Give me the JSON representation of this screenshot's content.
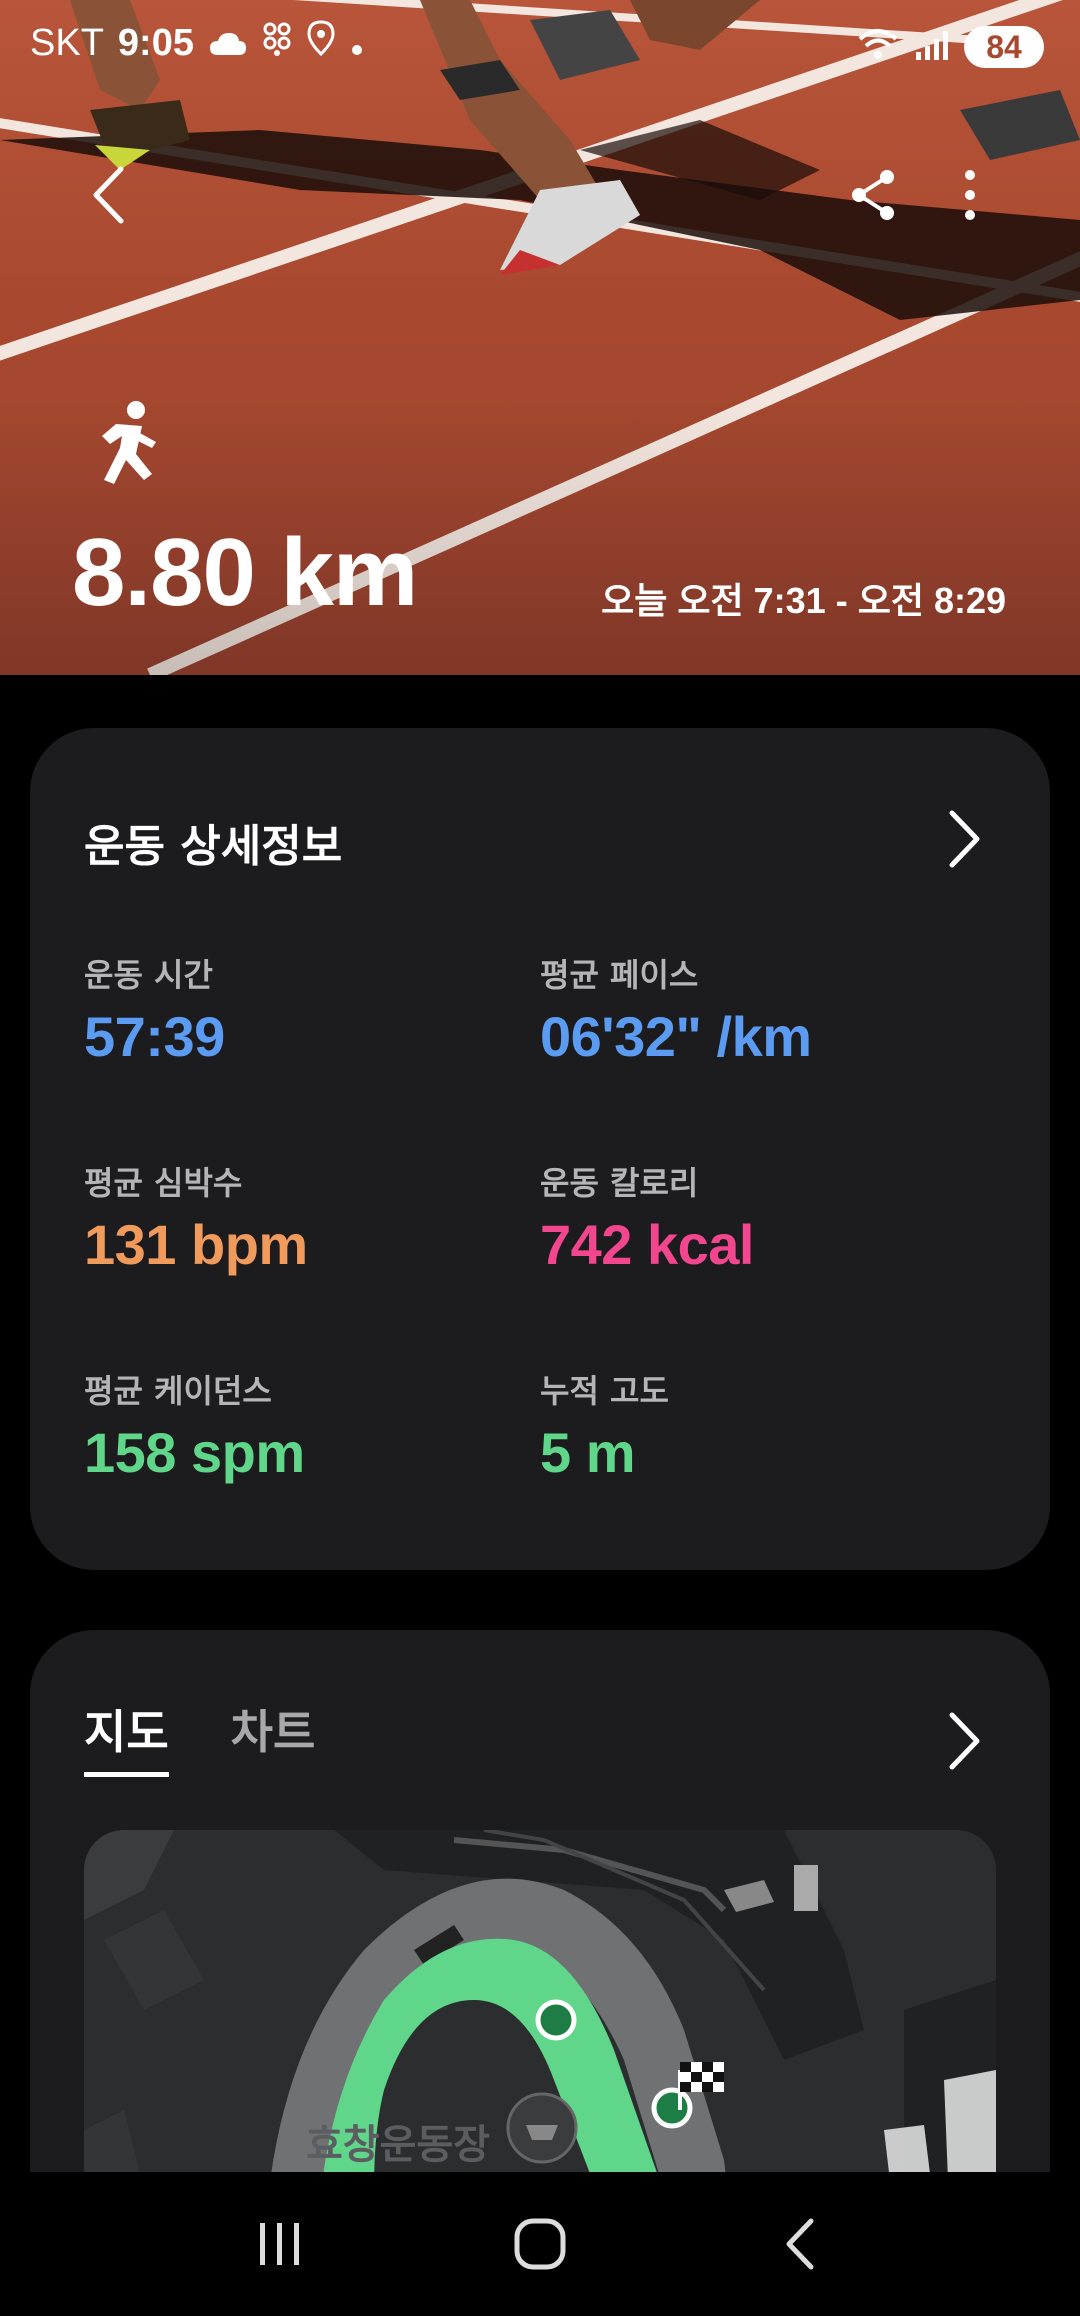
{
  "status_bar": {
    "carrier": "SKT",
    "time": "9:05",
    "battery": "84",
    "icons": [
      "cloud-icon",
      "grid-app-icon",
      "location-icon",
      "dot-icon",
      "wifi-icon",
      "signal-icon"
    ]
  },
  "hero": {
    "exercise_icon": "running-icon",
    "distance": "8.80 km",
    "time_range": "오늘 오전 7:31 - 오전 8:29"
  },
  "details": {
    "title": "운동 상세정보",
    "metrics": [
      {
        "label": "운동 시간",
        "value": "57:39",
        "color": "#5b9cf2"
      },
      {
        "label": "평균 페이스",
        "value": "06'32\" /km",
        "color": "#5b9cf2"
      },
      {
        "label": "평균 심박수",
        "value": "131 bpm",
        "color": "#f09a5c"
      },
      {
        "label": "운동 칼로리",
        "value": "742 kcal",
        "color": "#f2468f"
      },
      {
        "label": "평균 케이던스",
        "value": "158 spm",
        "color": "#5fd68a"
      },
      {
        "label": "누적 고도",
        "value": "5 m",
        "color": "#5fd68a"
      }
    ]
  },
  "map_card": {
    "tabs": [
      "지도",
      "차트"
    ],
    "active_tab": "지도",
    "map_label": "효창운동장",
    "route_color": "#5fd68a"
  }
}
